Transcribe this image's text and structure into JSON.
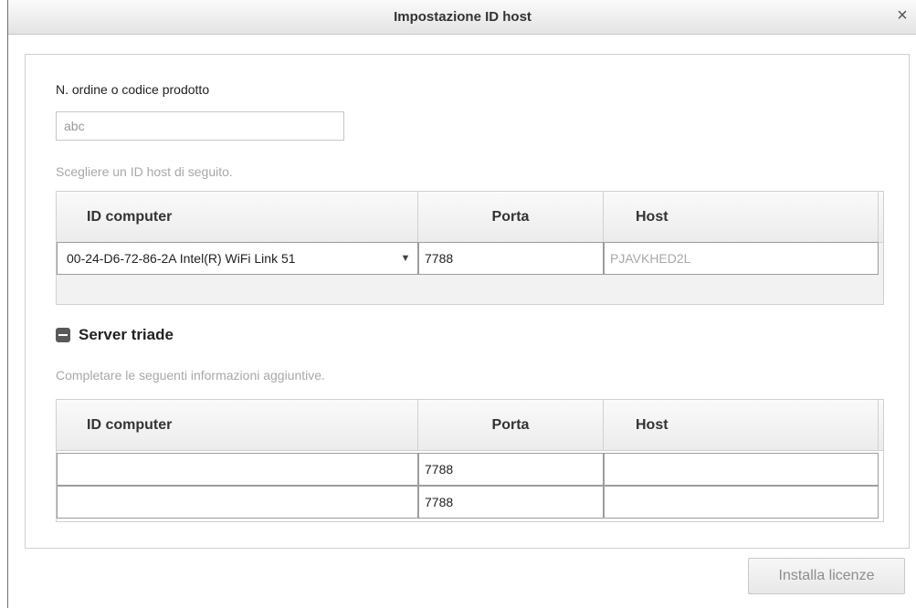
{
  "window": {
    "title": "Impostazione ID host",
    "close_glyph": "×"
  },
  "order": {
    "label": "N. ordine o codice prodotto",
    "value": "abc"
  },
  "host_id_section": {
    "hint": "Scegliere un ID host di seguito.",
    "columns": [
      "ID computer",
      "Porta",
      "Host"
    ],
    "row": {
      "computer_id": "00-24-D6-72-86-2A    Intel(R) WiFi Link 51",
      "port": "7788",
      "host": "PJAVKHED2L"
    }
  },
  "triad_section": {
    "title": "Server triade",
    "hint": "Completare le seguenti informazioni aggiuntive.",
    "columns": [
      "ID computer",
      "Porta",
      "Host"
    ],
    "rows": [
      {
        "computer_id": "",
        "port": "7788",
        "host": ""
      },
      {
        "computer_id": "",
        "port": "7788",
        "host": ""
      }
    ]
  },
  "footer": {
    "install_label": "Installa licenze"
  }
}
